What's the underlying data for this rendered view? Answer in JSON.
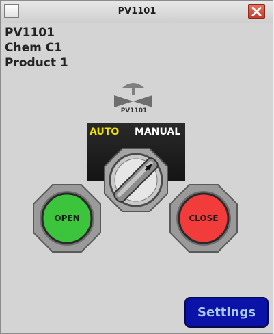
{
  "window": {
    "title": "PV1101",
    "close_icon": "close-x-icon",
    "close_color": "#d9523e"
  },
  "info": {
    "tag": "PV1101",
    "unit": "Chem C1",
    "product": "Product 1"
  },
  "valve": {
    "icon": "control-valve-icon",
    "label": "PV1101"
  },
  "selector": {
    "auto_label": "AUTO",
    "manual_label": "MANUAL",
    "position": "AUTO",
    "auto_color": "#f4e400"
  },
  "buttons": {
    "open_label": "OPEN",
    "open_color": "#3cc43c",
    "close_label": "CLOSE",
    "close_color": "#f23c3c"
  },
  "settings": {
    "label": "Settings",
    "color": "#0b12a8"
  }
}
